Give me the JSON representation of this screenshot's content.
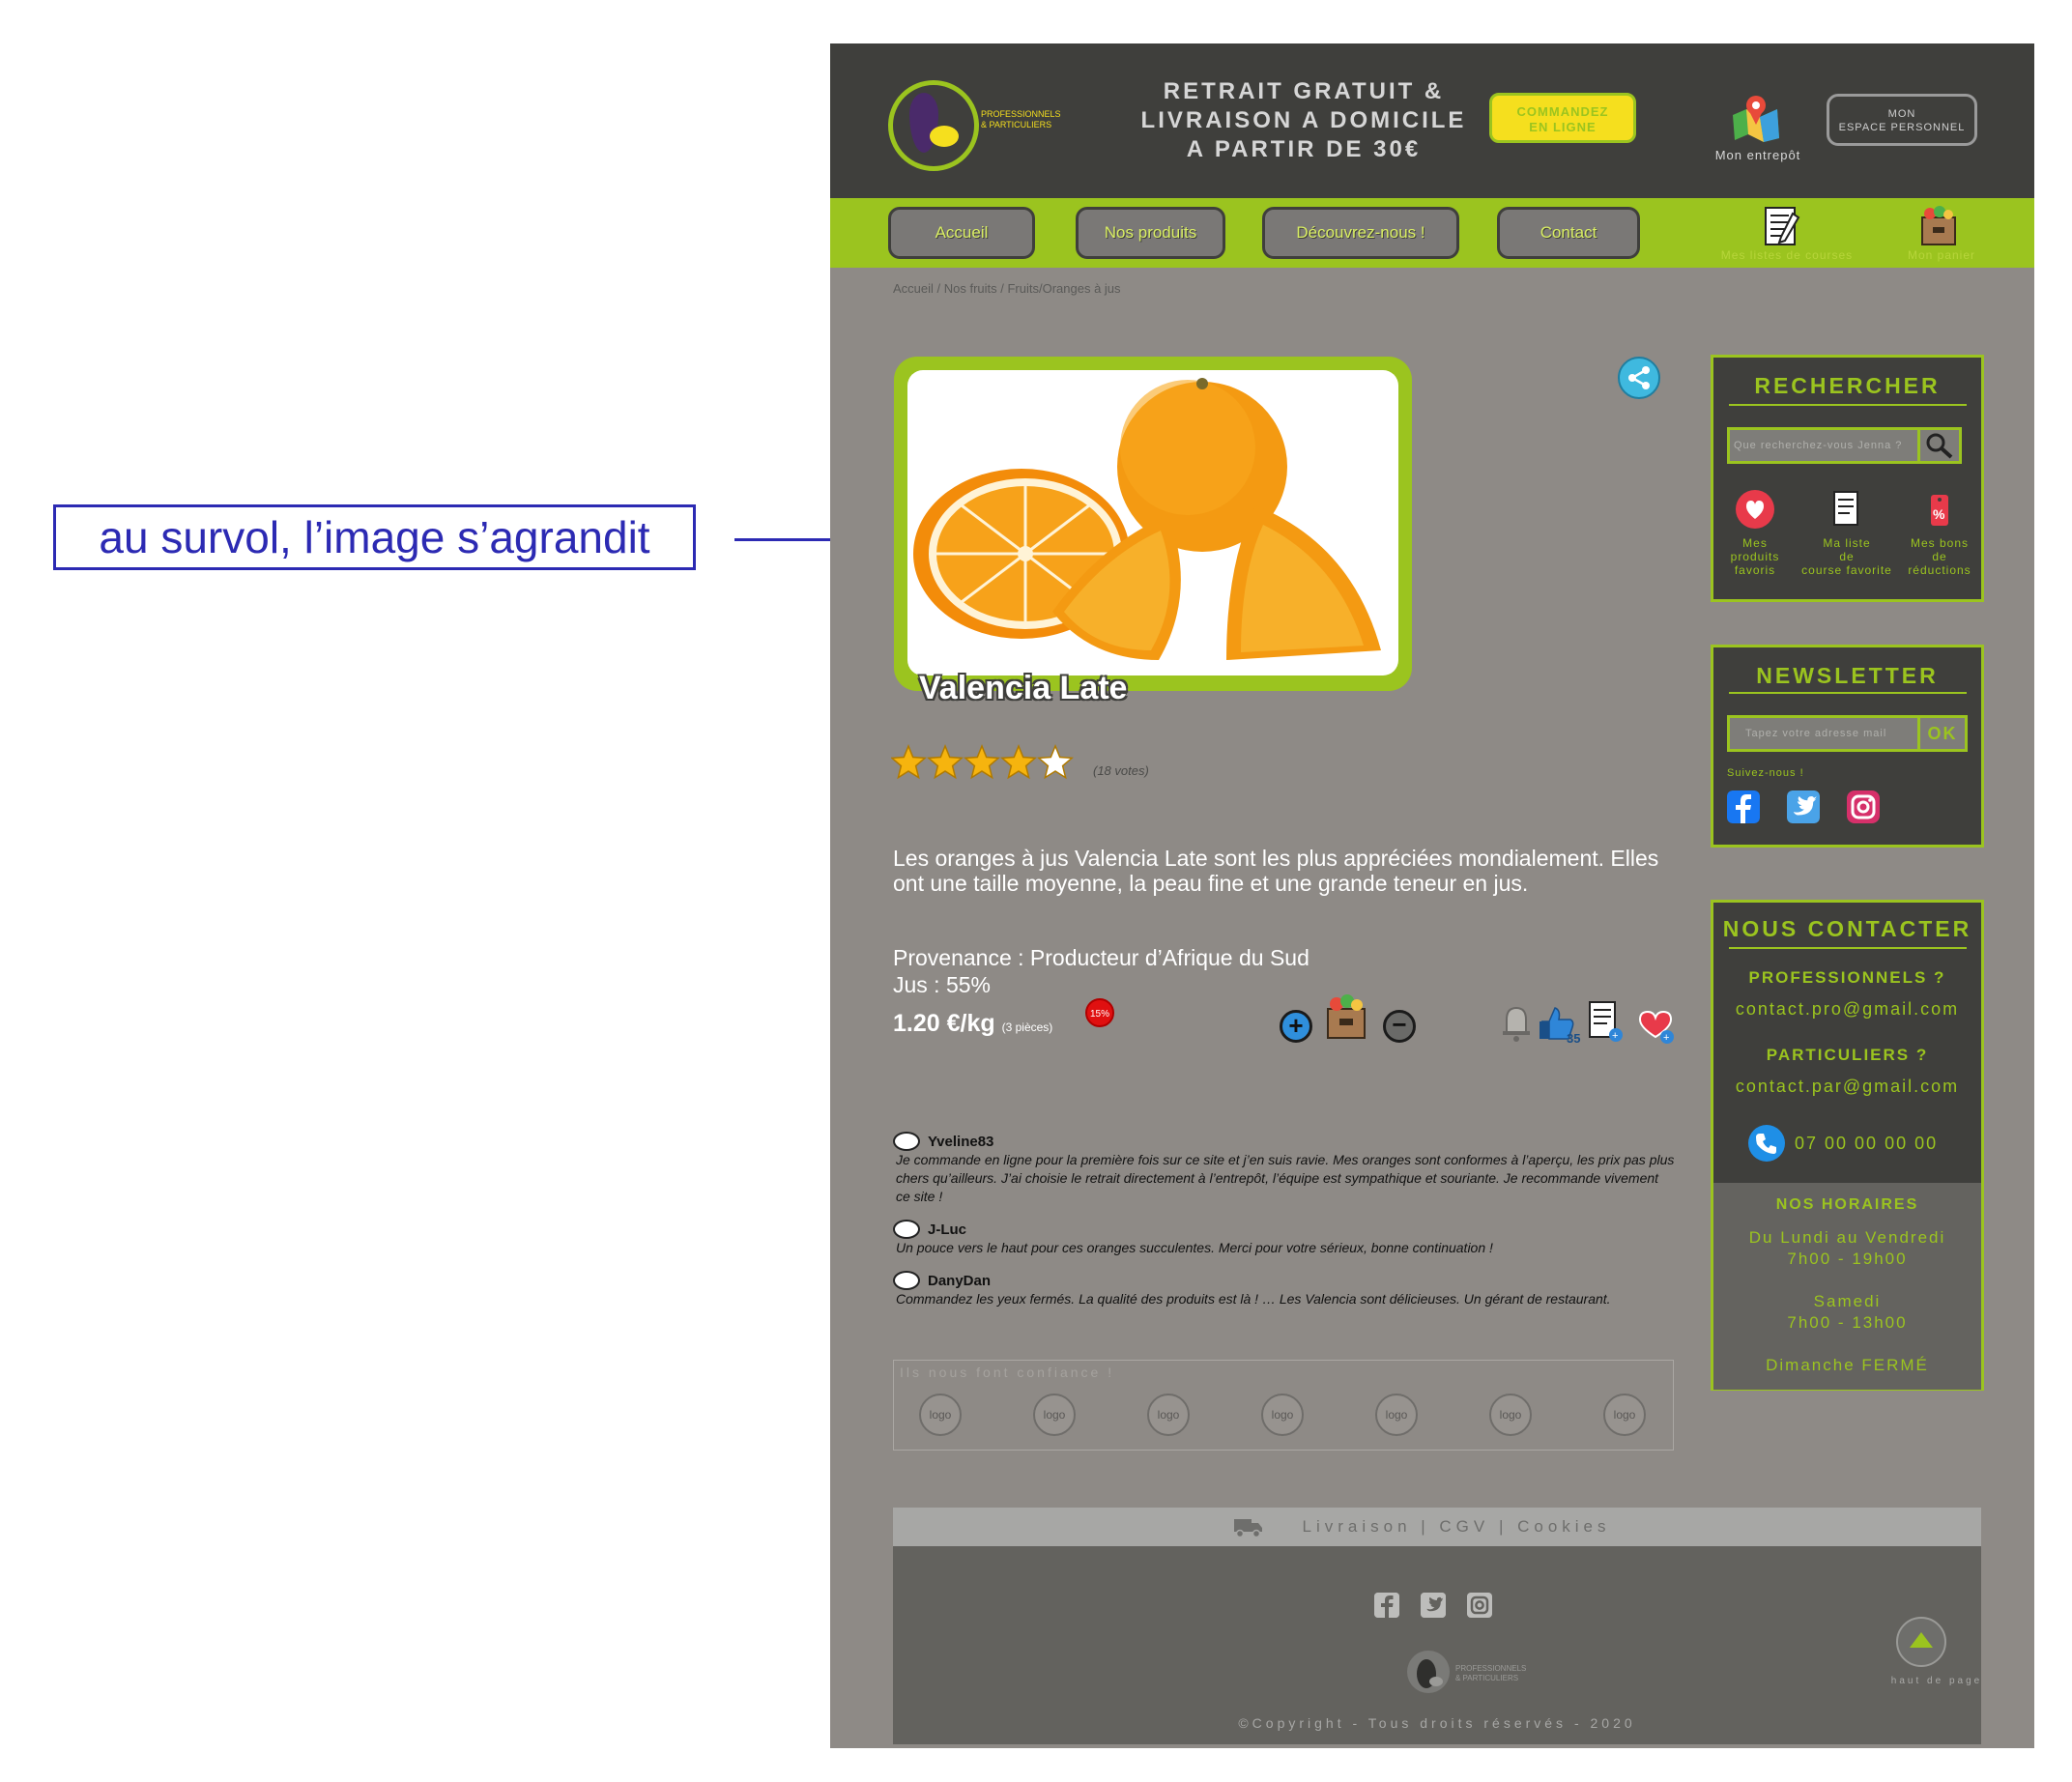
{
  "annotation": {
    "text": "au survol, l’image s’agrandit"
  },
  "header": {
    "logo_text_1": "PROFESSIONNELS",
    "logo_text_2": "& PARTICULIERS",
    "promo_line_1": "RETRAIT GRATUIT &",
    "promo_line_2": "LIVRAISON A DOMICILE",
    "promo_line_3": "A PARTIR DE 30€",
    "order_line_1": "COMMANDEZ",
    "order_line_2": "EN LIGNE",
    "warehouse_label": "Mon entrepôt",
    "space_line_1": "MON",
    "space_line_2": "ESPACE PERSONNEL"
  },
  "nav": {
    "items": [
      "Accueil",
      "Nos produits",
      "Découvrez-nous !",
      "Contact"
    ],
    "lists_label": "Mes listes de courses",
    "cart_label": "Mon panier"
  },
  "breadcrumb": "Accueil / Nos fruits / Fruits/Oranges à jus",
  "product": {
    "name": "Valencia Late",
    "rating": 4,
    "rating_max": 5,
    "votes": "(18 votes)",
    "description": "Les oranges à jus Valencia Late sont les plus appréciées mondialement. Elles ont une taille moyenne, la peau fine et une grande teneur en jus.",
    "origin": "Provenance : Producteur d’Afrique du Sud",
    "juice": "Jus : 55%",
    "price": "1.20 €/kg",
    "price_note": "(3 pièces)",
    "discount_badge": "15%",
    "likes_count": "35"
  },
  "reviews": [
    {
      "author": "Yveline83",
      "text": "Je commande en ligne pour la première fois sur ce site et j’en suis ravie. Mes oranges sont conformes à l’aperçu, les prix pas plus chers qu’ailleurs. J’ai choisie le retrait directement à l’entrepôt, l’équipe est sympathique et souriante. Je recommande vivement ce site !"
    },
    {
      "author": "J-Luc",
      "text": "Un pouce vers le haut pour ces oranges succulentes. Merci pour votre sérieux, bonne continuation !"
    },
    {
      "author": "DanyDan",
      "text": "Commandez les yeux fermés. La qualité des produits est là ! … Les Valencia sont délicieuses. Un gérant de restaurant."
    }
  ],
  "partners": {
    "title": "Ils nous font confiance !",
    "logos": [
      "logo",
      "logo",
      "logo",
      "logo",
      "logo",
      "logo",
      "logo"
    ]
  },
  "sidebar": {
    "search_title": "RECHERCHER",
    "search_placeholder": "Que recherchez-vous Jenna ?",
    "quick_links": [
      {
        "line1": "Mes",
        "line2": "produits",
        "line3": "favoris"
      },
      {
        "line1": "Ma liste",
        "line2": "de",
        "line3": "course favorite"
      },
      {
        "line1": "Mes bons",
        "line2": "de",
        "line3": "réductions"
      }
    ],
    "newsletter_title": "NEWSLETTER",
    "newsletter_placeholder": "Tapez votre adresse mail",
    "newsletter_button": "OK",
    "follow_label": "Suivez-nous !",
    "contact_title": "NOUS CONTACTER",
    "pro_label": "PROFESSIONNELS ?",
    "pro_mail": "contact.pro@gmail.com",
    "part_label": "PARTICULIERS ?",
    "part_mail": "contact.par@gmail.com",
    "phone": "07 00 00 00 00",
    "hours_title": "NOS HORAIRES",
    "hours_1": "Du Lundi au Vendredi",
    "hours_2": "7h00 - 19h00",
    "hours_3": "Samedi",
    "hours_4": "7h00 - 13h00",
    "hours_5": "Dimanche FERMÉ"
  },
  "footer": {
    "links": "Livraison | CGV | Cookies",
    "logo_text_1": "PROFESSIONNELS",
    "logo_text_2": "& PARTICULIERS",
    "copyright": "©Copyright - Tous droits réservés - 2020",
    "top_label": "haut de page"
  },
  "colors": {
    "accent": "#9bc41f",
    "dark": "#3f3f3c",
    "page_bg": "#8e8a86",
    "order_button": "#f5df1e"
  }
}
